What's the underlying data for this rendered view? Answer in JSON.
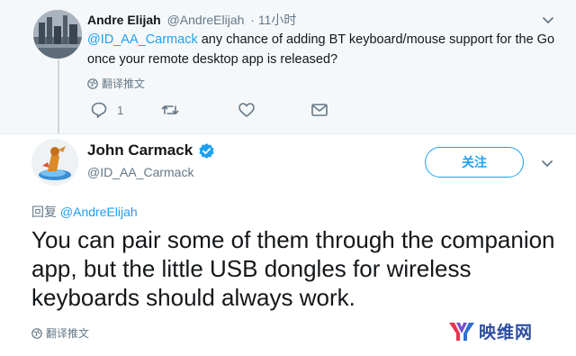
{
  "reply_tweet": {
    "name": "Andre Elijah",
    "handle": "@AndreElijah",
    "time": "· 11小时",
    "mention": "@ID_AA_Carmack",
    "text": " any chance of adding BT keyboard/mouse support for the Go once your remote desktop app is released?",
    "translate_label": "翻译推文",
    "reply_count": "1"
  },
  "main_tweet": {
    "name": "John Carmack",
    "handle": "@ID_AA_Carmack",
    "follow_label": "关注",
    "reply_to_prefix": "回复 ",
    "reply_to_handle": "@AndreElijah",
    "text": "You can pair some of them through the companion app, but the little USB dongles for wireless keyboards should always work.",
    "translate_label": "翻译推文"
  },
  "watermark": {
    "text": "映维网"
  },
  "colors": {
    "accent": "#1da1f2",
    "muted": "#657786",
    "text": "#14171a",
    "reply_bg": "#f5f8fa"
  },
  "icons": [
    "reply-icon",
    "retweet-icon",
    "like-icon",
    "direct-message-icon",
    "globe-icon",
    "verified-badge-icon",
    "chevron-down-icon"
  ]
}
